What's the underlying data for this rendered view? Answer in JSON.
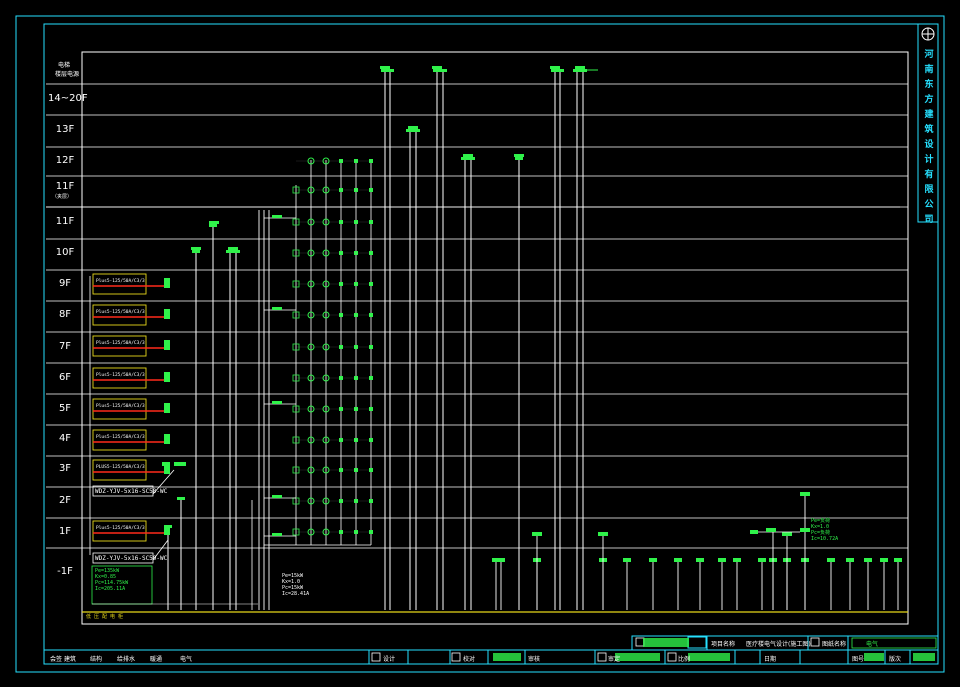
{
  "header": {
    "col_left_label_1": "电梯",
    "col_left_label_2": "楼层电源"
  },
  "floors": [
    "14~20F",
    "13F",
    "12F",
    "11F",
    "11F",
    "10F",
    "9F",
    "8F",
    "7F",
    "6F",
    "5F",
    "4F",
    "3F",
    "2F",
    "1F",
    "-1F"
  ],
  "floor_note_11": "（夹层）",
  "company": "河南东方建筑设计有限公司",
  "breaker_label": "Plus5-125/50A/C3/3",
  "breaker_label_3f": "PLUS5-125/50A/C3/3",
  "cable_label": "WDZ-YJV-5x16-SC50-WC",
  "load_calc_1": [
    "Pe=135kW",
    "Kx=0.85",
    "Pc=114.75kW",
    "Ic=205.11A"
  ],
  "load_calc_2": [
    "Pe=15kW",
    "Kx=1.0",
    "Pc=15kW",
    "Ic=28.41A"
  ],
  "load_calc_3": [
    "Pe=负荷",
    "Kx=1.0",
    "Pc=负荷",
    "Ic=10.72A"
  ],
  "bottom_bar_label": "低 压 配 电 柜",
  "title_block": {
    "proj_label": "项目名称",
    "proj_value": "医疗楼电气设计(施工图)",
    "drawing_label": "图纸名称",
    "designer": "设计",
    "checker": "校对",
    "reviewer": "审核",
    "approver": "审定",
    "discipline": "电气",
    "row2_items": [
      "会签",
      "建筑",
      "结构",
      "给排水",
      "暖通",
      "电气"
    ],
    "scale_label": "比例",
    "date_label": "日期",
    "sheet_label": "图号",
    "version_label": "版次"
  },
  "colors": {
    "line": "#ffffff",
    "green": "#2ff24a",
    "red": "#ff2a1a",
    "yellow": "#e6d81a",
    "cyan": "#26e0ff"
  }
}
